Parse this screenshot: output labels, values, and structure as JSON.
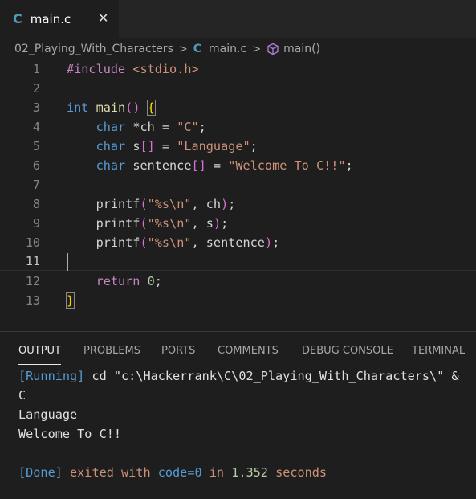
{
  "tab": {
    "icon": "c-language-icon",
    "icon_text": "C",
    "filename": "main.c",
    "close": "✕"
  },
  "breadcrumb": {
    "folder": "02_Playing_With_Characters",
    "file_icon_text": "C",
    "file": "main.c",
    "symbol": "main()"
  },
  "code_lines": [
    {
      "n": "1"
    },
    {
      "n": "2"
    },
    {
      "n": "3"
    },
    {
      "n": "4"
    },
    {
      "n": "5"
    },
    {
      "n": "6"
    },
    {
      "n": "7"
    },
    {
      "n": "8"
    },
    {
      "n": "9"
    },
    {
      "n": "10"
    },
    {
      "n": "11"
    },
    {
      "n": "12"
    },
    {
      "n": "13"
    }
  ],
  "code": {
    "l1": {
      "pp": "#include",
      "hdr": "<stdio.h>"
    },
    "l3": {
      "type": "int",
      "fn": "main",
      "paren": "()",
      "brace": "{"
    },
    "l4": {
      "type": "char",
      "rest": "*ch = ",
      "str": "\"C\"",
      "end": ";"
    },
    "l5": {
      "type": "char",
      "var": "s",
      "open": "[",
      "close": "]",
      "mid": " = ",
      "str": "\"Language\"",
      "end": ";"
    },
    "l6": {
      "type": "char",
      "var": "sentence",
      "open": "[",
      "close": "]",
      "mid": " = ",
      "str": "\"Welcome To C!!\"",
      "end": ";"
    },
    "l8": {
      "fn": "printf",
      "open": "(",
      "str1": "\"%s",
      "esc": "\\n",
      "str2": "\"",
      "args": ", ch",
      "close": ")",
      "end": ";"
    },
    "l9": {
      "fn": "printf",
      "open": "(",
      "str1": "\"%s",
      "esc": "\\n",
      "str2": "\"",
      "args": ", s",
      "close": ")",
      "end": ";"
    },
    "l10": {
      "fn": "printf",
      "open": "(",
      "str1": "\"%s",
      "esc": "\\n",
      "str2": "\"",
      "args": ", sentence",
      "close": ")",
      "end": ";"
    },
    "l12": {
      "kw": "return",
      "sp": " ",
      "num": "0",
      "end": ";"
    },
    "l13": {
      "brace": "}"
    }
  },
  "panel": {
    "tabs": [
      "OUTPUT",
      "PROBLEMS",
      "PORTS",
      "COMMENTS",
      "DEBUG CONSOLE",
      "TERMINAL"
    ],
    "active": "OUTPUT"
  },
  "output": {
    "running_tag": "[Running]",
    "running_cmd": " cd \"c:\\Hackerrank\\C\\02_Playing_With_Characters\\\" &",
    "lines": [
      "C",
      "Language",
      "Welcome To C!!",
      ""
    ],
    "done_tag": "[Done]",
    "done_text1": " exited with ",
    "done_code": "code=0",
    "done_text2": " in ",
    "done_time": "1.352",
    "done_text3": " seconds"
  },
  "colors": {
    "accent": "#519aba",
    "editor_bg": "#1e1e1e",
    "keyword": "#569cd6",
    "string": "#ce9178"
  }
}
